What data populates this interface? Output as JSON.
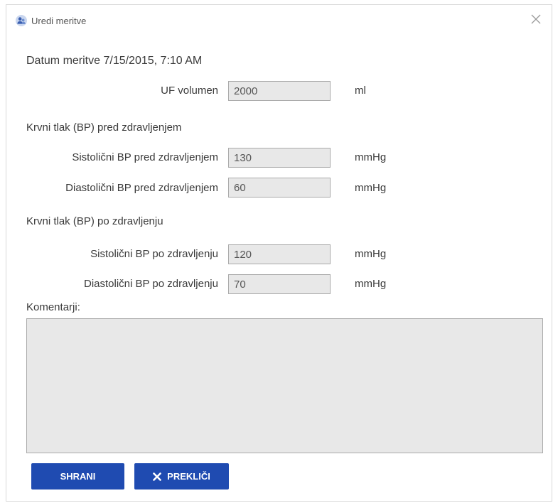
{
  "window": {
    "title": "Uredi meritve",
    "icon": "user-group-icon",
    "close_icon": "close-icon"
  },
  "form": {
    "date_text": "Datum meritve 7/15/2015, 7:10 AM",
    "uf": {
      "label": "UF volumen",
      "value": "2000",
      "unit": "ml"
    },
    "pre_section_title": "Krvni tlak (BP) pred zdravljenjem",
    "pre_systolic": {
      "label": "Sistolični BP pred zdravljenjem",
      "value": "130",
      "unit": "mmHg"
    },
    "pre_diastolic": {
      "label": "Diastolični BP pred zdravljenjem",
      "value": "60",
      "unit": "mmHg"
    },
    "post_section_title": "Krvni tlak (BP) po zdravljenju",
    "post_systolic": {
      "label": "Sistolični BP po zdravljenju",
      "value": "120",
      "unit": "mmHg"
    },
    "post_diastolic": {
      "label": "Diastolični BP po zdravljenju",
      "value": "70",
      "unit": "mmHg"
    },
    "comments_label": "Komentarji:",
    "comments_value": ""
  },
  "buttons": {
    "save_label": "SHRANI",
    "cancel_label": "PREKLIČI",
    "cancel_icon": "x-icon"
  },
  "colors": {
    "primary_button": "#1f4bb1",
    "field_background": "#e8e8e8",
    "field_border": "#a9a9a9"
  }
}
